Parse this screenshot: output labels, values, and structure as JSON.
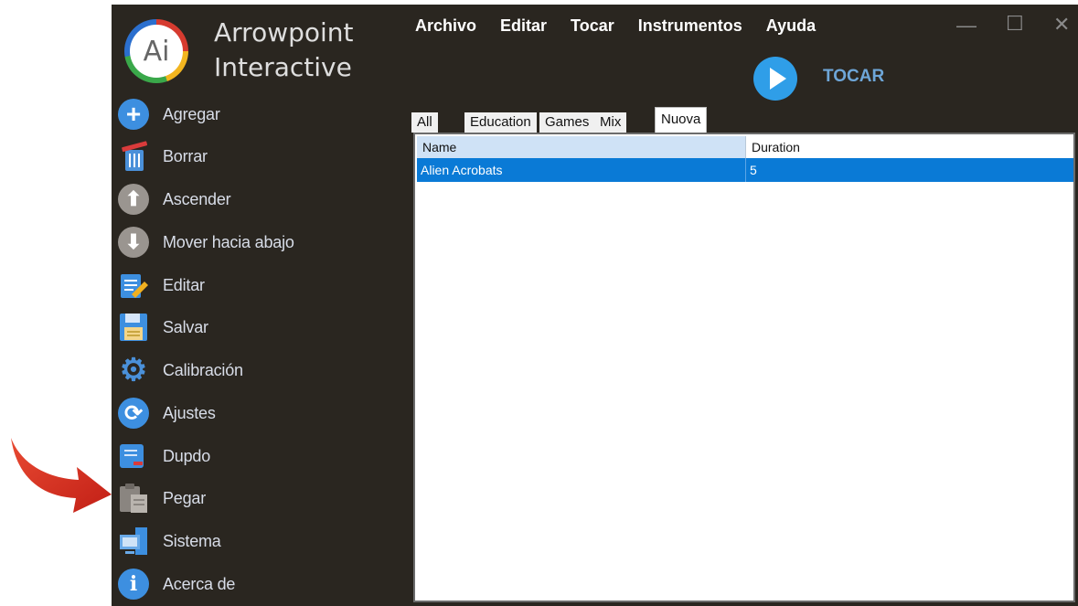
{
  "brand": {
    "logo_text": "Ai",
    "line1": "Arrowpoint",
    "line2": "Interactive"
  },
  "menu": [
    "Archivo",
    "Editar",
    "Tocar",
    "Instrumentos",
    "Ayuda"
  ],
  "window_controls": {
    "minimize": "—",
    "maximize": "☐",
    "close": "✕"
  },
  "play": {
    "label": "TOCAR"
  },
  "sidebar": {
    "items": [
      {
        "label": "Agregar",
        "icon": "add-icon"
      },
      {
        "label": "Borrar",
        "icon": "trash-icon"
      },
      {
        "label": "Ascender",
        "icon": "arrow-up-icon"
      },
      {
        "label": "Mover hacia abajo",
        "icon": "arrow-down-icon"
      },
      {
        "label": "Editar",
        "icon": "edit-icon"
      },
      {
        "label": "Salvar",
        "icon": "save-icon"
      },
      {
        "label": "Calibración",
        "icon": "gear-icon"
      },
      {
        "label": "Ajustes",
        "icon": "refresh-icon"
      },
      {
        "label": "Dupdo",
        "icon": "copy-icon"
      },
      {
        "label": "Pegar",
        "icon": "paste-icon"
      },
      {
        "label": "Sistema",
        "icon": "system-icon"
      },
      {
        "label": "Acerca de",
        "icon": "info-icon"
      }
    ]
  },
  "tabs": [
    {
      "label": "All"
    },
    {
      "label": "Education"
    },
    {
      "label": "Games"
    },
    {
      "label": "Mix"
    },
    {
      "label": "Nuova",
      "active": true
    }
  ],
  "table": {
    "columns": [
      "Name",
      "Duration"
    ],
    "rows": [
      {
        "name": "Alien Acrobats",
        "duration": "5",
        "selected": true
      }
    ]
  },
  "colors": {
    "background": "#2a2620",
    "accent": "#0a7ad6",
    "play": "#2f9ee8"
  }
}
